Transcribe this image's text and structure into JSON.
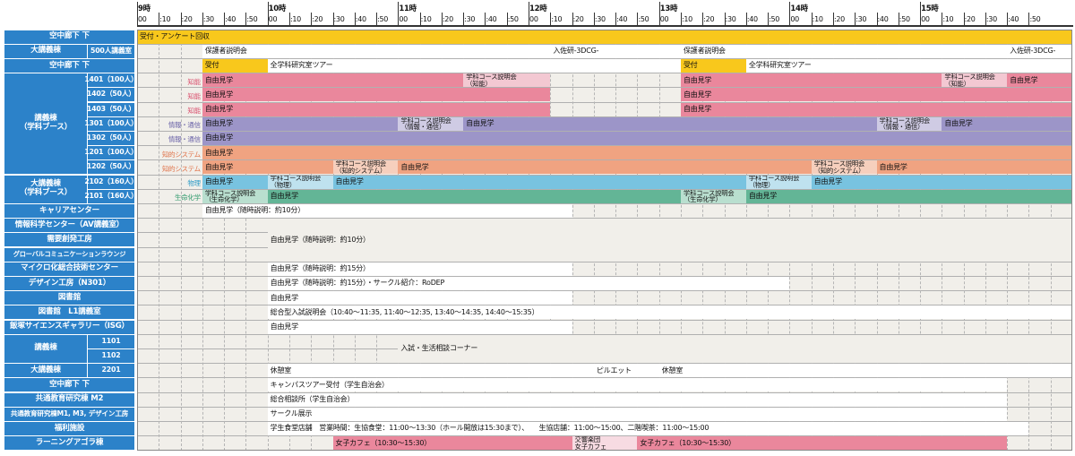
{
  "header": {
    "hours": [
      "9時",
      "10時",
      "11時",
      "12時",
      "13時",
      "14時",
      "15時"
    ],
    "minutes": [
      "00",
      ":10",
      ":20",
      ":30",
      ":40",
      ":50"
    ]
  },
  "colors": {
    "label_bg": "#2c82c9",
    "yellow": "#f8c81c",
    "pink": "#ea879c",
    "pink_light": "#f3c8d2",
    "purple": "#9c95c8",
    "purple_light": "#cfcbe4",
    "orange": "#f0a381",
    "orange_light": "#f6cfbd",
    "cyan": "#78c3e0",
    "cyan_light": "#bfe2ef",
    "green": "#63b596",
    "green_light": "#b9dfcf",
    "grid_bg": "#f1efea"
  },
  "rows": [
    {
      "label": "空中廊下 下"
    },
    {
      "label": "大講義棟",
      "sub": "500人講義室"
    },
    {
      "label": "空中廊下 下"
    },
    {
      "label": "講義棟\n（学科ブース）",
      "sub": "1401（100人）",
      "dept": "知能"
    },
    {
      "sub": "1402（50人）",
      "dept": "知能"
    },
    {
      "sub": "1403（50人）",
      "dept": "知能"
    },
    {
      "sub": "1301（100人）",
      "dept": "情報・通信"
    },
    {
      "sub": "1302（50人）",
      "dept": "情報・通信"
    },
    {
      "sub": "1201（100人）",
      "dept": "知的システム"
    },
    {
      "sub": "1202（50人）",
      "dept": "知的システム"
    },
    {
      "label": "大講義棟\n（学科ブース）",
      "sub": "2102（160人）",
      "dept": "物理"
    },
    {
      "sub": "2101（160人）",
      "dept": "生命化学"
    },
    {
      "label": "キャリアセンター"
    },
    {
      "label": "情報科学センター（AV講義室）"
    },
    {
      "label": "需要創発工房"
    },
    {
      "label": "グローバルコミュニケーションラウンジ"
    },
    {
      "label": "マイクロ化総合技術センター"
    },
    {
      "label": "デザイン工房（N301）"
    },
    {
      "label": "図書館"
    },
    {
      "label": "図書館　L1講義室"
    },
    {
      "label": "飯塚サイエンスギャラリー（ISG）"
    },
    {
      "label": "講義棟",
      "sub": "1101"
    },
    {
      "sub": "1102"
    },
    {
      "label": "大講義棟",
      "sub": "2201"
    },
    {
      "label": "空中廊下 下"
    },
    {
      "label": "共通教育研究棟 M2"
    },
    {
      "label": "共通教育研究棟M1, M3, デザイン工房"
    },
    {
      "label": "福利施設"
    },
    {
      "label": "ラーニングアゴラ棟"
    }
  ],
  "events": [
    {
      "row": 0,
      "start": 0,
      "end": 72,
      "text": "受付・アンケート回収",
      "color": "yellow"
    },
    {
      "row": 1,
      "start": 12,
      "end": 45,
      "text": "保護者説明会",
      "color": "white"
    },
    {
      "row": 1,
      "start": 46,
      "end": 72,
      "text": "入佐研-3DCG-",
      "color": "white"
    },
    {
      "row": 1,
      "start": 60,
      "end": 72,
      "text": "保護者説明会",
      "color": "white"
    },
    {
      "row": 1,
      "start": 96,
      "end": 105,
      "text": "入佐研-3DCG-",
      "color": "white"
    },
    {
      "row": 2,
      "start": 12,
      "end": 24,
      "text": "受付",
      "color": "yellow"
    },
    {
      "row": 2,
      "start": 24,
      "end": 108,
      "text": "全学科研究室ツアー",
      "color": "white"
    },
    {
      "row": 2,
      "start": 60,
      "end": 72,
      "text": "受付",
      "color": "yellow"
    },
    {
      "row": 2,
      "start": 72,
      "end": 96,
      "text": "全学科研究室ツアー",
      "color": "white"
    }
  ],
  "block_texts": {
    "free": "自由見学",
    "course": "学科コース説明会",
    "course_chino": "学科コース説明会\n（知能）",
    "course_joho": "学科コース説明会\n（情報・通信）",
    "course_chiteki": "学科コース説明会\n（知的システム）",
    "course_butsuri": "学科コース説明会\n（物理）",
    "course_seimei": "学科コース説明会\n（生命化学）",
    "career": "自由見学（随時説明：約10分）",
    "av": "自由見学（随時説明：約10分）",
    "micro": "自由見学（随時説明：約15分）",
    "design": "自由見学（随時説明：約15分）・サークル紹介：RoDEP",
    "library": "自由見学",
    "l1": "総合型入試説明会（10:40～11:35, 11:40～12:35, 13:40～14:35, 14:40～15:35）",
    "isg": "自由見学",
    "consult": "入試・生活相談コーナー",
    "rest1": "休憩室",
    "pilet": "ピルエット",
    "rest2": "休憩室",
    "campus_tour": "キャンパスツアー受付（学生自治会）",
    "sogo": "総合相談所（学生自治会）",
    "circle": "サークル展示",
    "welfare": "学生食堂店舗　営業時間：生協食堂：11:00～13:30（ホール開放は15:30まで）、　　生協店舗：11:00～15:00、二階喫茶：11:00～15:00",
    "cafe1": "女子カフェ（10:30～15:30）",
    "kyokyo": "交響楽団\n女子カフェ",
    "cafe2": "女子カフェ（10:30～15:30）"
  }
}
